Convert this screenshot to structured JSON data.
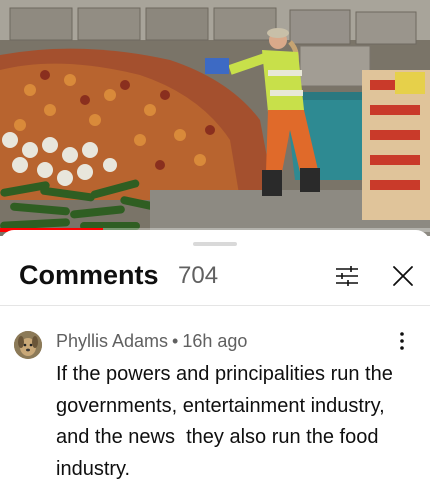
{
  "video": {
    "progress_fraction": 0.24,
    "progress_color": "#ff0000"
  },
  "comments_panel": {
    "title": "Comments",
    "count": "704",
    "filter_icon": "filter-sliders-icon",
    "close_icon": "close-x-icon"
  },
  "comment": {
    "author": "Phyllis Adams",
    "separator": "•",
    "time_ago": "16h ago",
    "text": "If the powers and principalities run the governments, entertainment industry, and the news  they also run the food industry.",
    "menu_icon": "more-vertical-icon"
  }
}
